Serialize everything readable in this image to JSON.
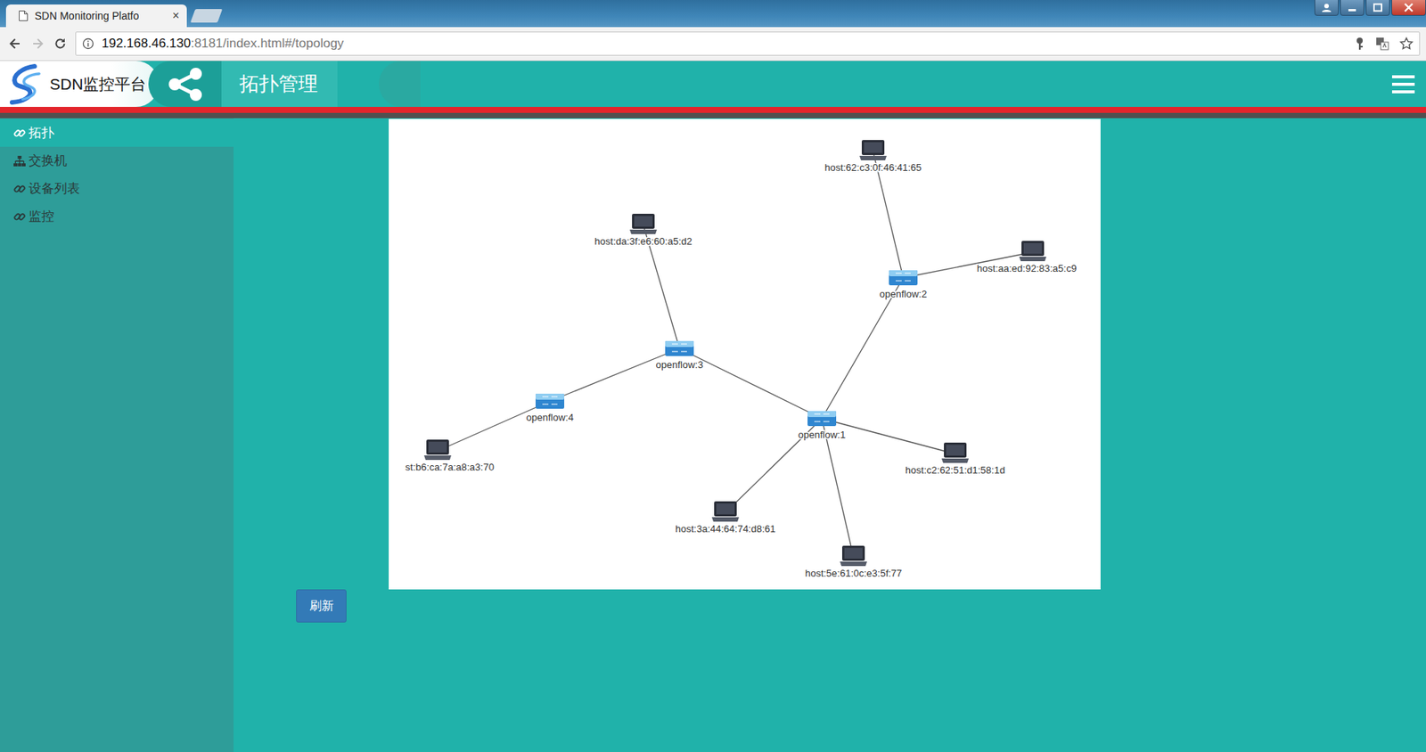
{
  "window": {
    "title": "SDN Monitoring Platfo",
    "close": "×"
  },
  "address_bar": {
    "host": "192.168.46.130",
    "rest": ":8181/index.html#/topology"
  },
  "header": {
    "brand": "SDN监控平台",
    "title": "拓扑管理"
  },
  "sidebar": {
    "items": [
      {
        "label": "拓扑",
        "selected": true,
        "kind": "link"
      },
      {
        "label": "交换机",
        "selected": false,
        "kind": "sitemap"
      },
      {
        "label": "设备列表",
        "selected": false,
        "kind": "link"
      },
      {
        "label": "监控",
        "selected": false,
        "kind": "link"
      }
    ]
  },
  "topology": {
    "nodes": [
      {
        "label": "host:62:c3:0f:46:41:65",
        "kind": "host"
      },
      {
        "label": "openflow:2",
        "kind": "switch"
      },
      {
        "label": "host:aa:ed:92:83:a5:c9",
        "kind": "host"
      },
      {
        "label": "host:da:3f:e6:60:a5:d2",
        "kind": "host"
      },
      {
        "label": "openflow:3",
        "kind": "switch"
      },
      {
        "label": "openflow:4",
        "kind": "switch"
      },
      {
        "label": "st:b6:ca:7a:a8:a3:70",
        "kind": "host"
      },
      {
        "label": "openflow:1",
        "kind": "switch"
      },
      {
        "label": "host:c2:62:51:d1:58:1d",
        "kind": "host"
      },
      {
        "label": "host:3a:44:64:74:d8:61",
        "kind": "host"
      },
      {
        "label": "host:5e:61:0c:e3:5f:77",
        "kind": "host"
      }
    ],
    "links": [
      {
        "from": "host:62:c3:0f:46:41:65",
        "to": "openflow:2"
      },
      {
        "from": "host:aa:ed:92:83:a5:c9",
        "to": "openflow:2"
      },
      {
        "from": "openflow:2",
        "to": "openflow:1"
      },
      {
        "from": "host:da:3f:e6:60:a5:d2",
        "to": "openflow:3"
      },
      {
        "from": "openflow:3",
        "to": "openflow:4"
      },
      {
        "from": "openflow:3",
        "to": "openflow:1"
      },
      {
        "from": "openflow:4",
        "to": "st:b6:ca:7a:a8:a3:70"
      },
      {
        "from": "openflow:1",
        "to": "host:c2:62:51:d1:58:1d"
      },
      {
        "from": "openflow:1",
        "to": "host:3a:44:64:74:d8:61"
      },
      {
        "from": "openflow:1",
        "to": "host:5e:61:0c:e3:5f:77"
      }
    ]
  },
  "buttons": [
    "刷新"
  ]
}
